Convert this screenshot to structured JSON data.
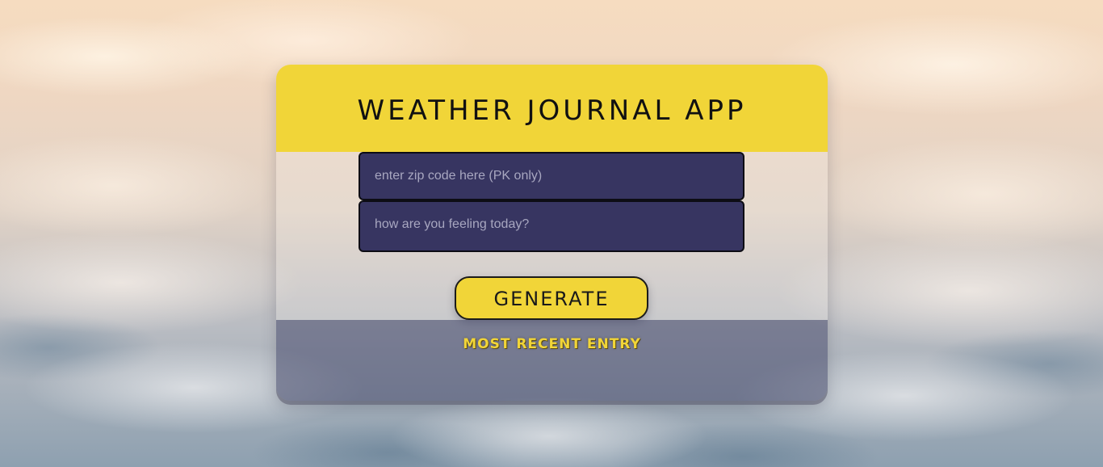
{
  "app": {
    "title": "WEATHER JOURNAL APP"
  },
  "form": {
    "zip_placeholder": "enter zip code here (PK only)",
    "zip_value": "",
    "feelings_placeholder": "how are you feeling today?",
    "feelings_value": "",
    "generate_label": "GENERATE"
  },
  "entry": {
    "title": "MOST RECENT ENTRY"
  },
  "colors": {
    "accent": "#f1d538",
    "input_bg": "#373561",
    "entry_bg": "#46486c"
  },
  "background": {
    "description_icon": "clouds-background"
  }
}
